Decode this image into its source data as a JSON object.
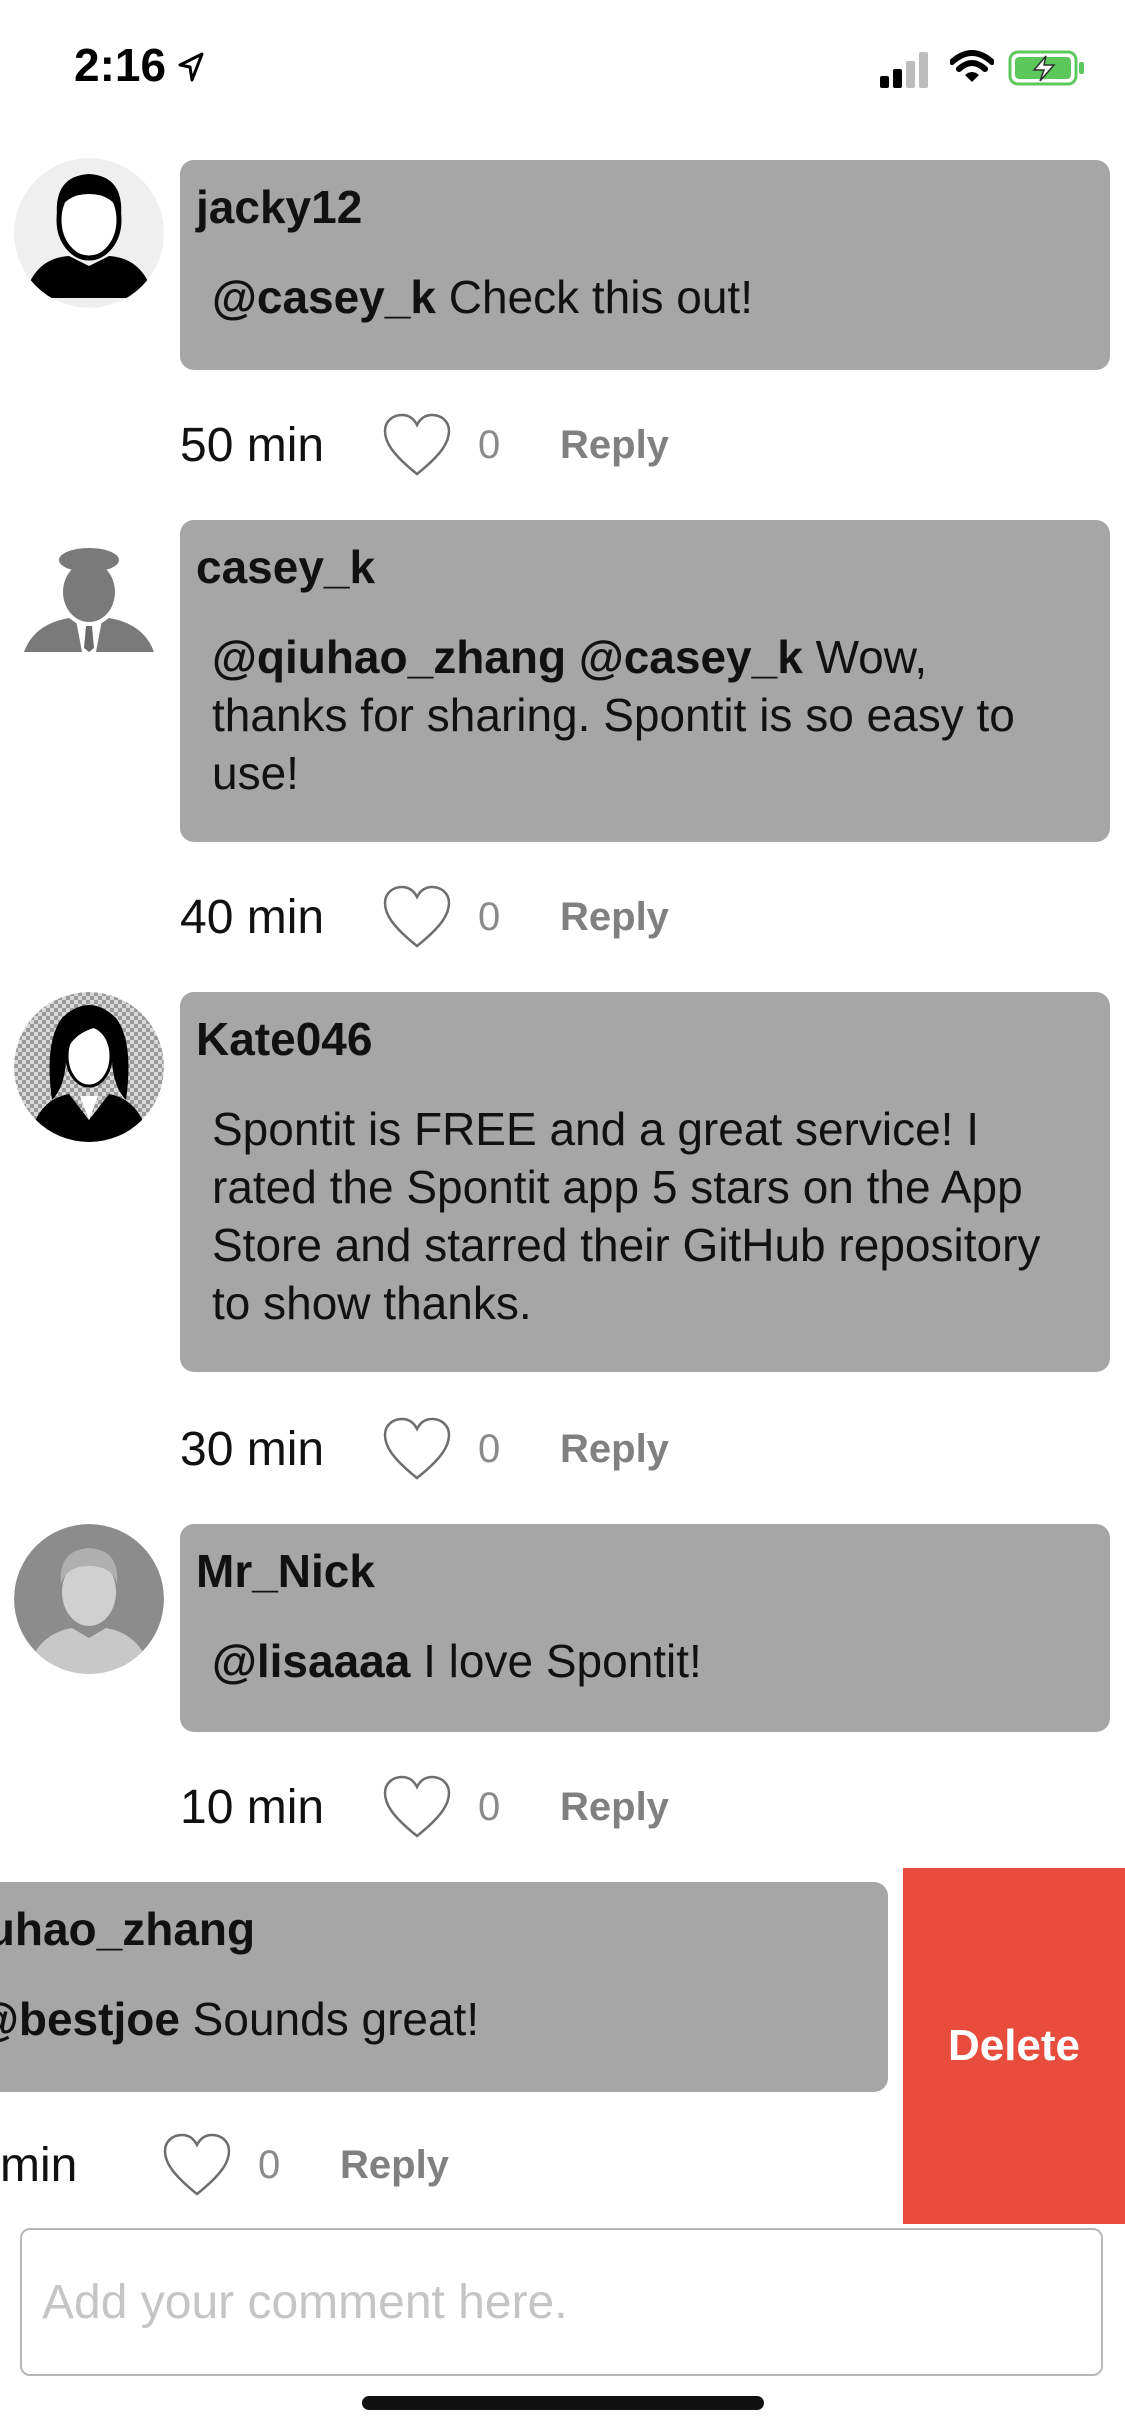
{
  "status_bar": {
    "time": "2:16",
    "icons": [
      "location-arrow-icon",
      "cellular-signal-icon",
      "wifi-icon",
      "battery-charging-icon"
    ],
    "battery_color": "#5cc85c"
  },
  "comments": [
    {
      "username": "jacky12",
      "mentions": "@casey_k",
      "text": " Check this out!",
      "time": "50 min",
      "likes": "0",
      "reply": "Reply",
      "avatar": "male-silhouette-avatar"
    },
    {
      "username": "casey_k",
      "mentions": "@qiuhao_zhang @casey_k",
      "text": " Wow, thanks for sharing. Spontit is so easy to use!",
      "time": "40 min",
      "likes": "0",
      "reply": "Reply",
      "avatar": "businessman-avatar"
    },
    {
      "username": "Kate046",
      "mentions": "",
      "text": "Spontit is FREE and a great service! I rated the Spontit app 5 stars on the App Store and starred their GitHub repository to show thanks.",
      "time": "30 min",
      "likes": "0",
      "reply": "Reply",
      "avatar": "female-silhouette-avatar"
    },
    {
      "username": "Mr_Nick",
      "mentions": "@lisaaaa",
      "text": " I love Spontit!",
      "time": "10 min",
      "likes": "0",
      "reply": "Reply",
      "avatar": "default-person-avatar"
    },
    {
      "username": "iuhao_zhang",
      "mentions": "@bestjoe",
      "text": " Sounds great!",
      "time": "min",
      "likes": "0",
      "reply": "Reply",
      "avatar": ""
    }
  ],
  "swipe_action": {
    "label": "Delete",
    "color": "#e74c3c"
  },
  "composer": {
    "placeholder": "Add your comment here."
  },
  "colors": {
    "bubble": "#a6a6a6",
    "reply": "#808080"
  }
}
